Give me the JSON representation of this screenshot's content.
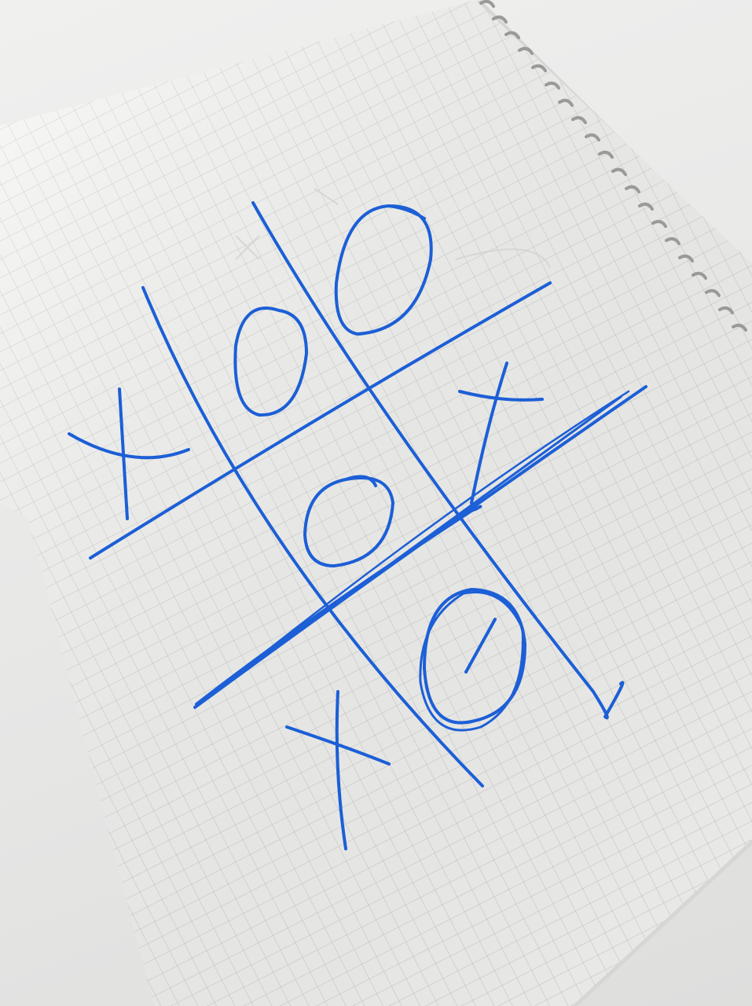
{
  "scene": {
    "subject": "hand-drawn-tic-tac-toe",
    "ink_color": "#1c5fd6",
    "paper_color": "#f7f7f5",
    "grid_line_color": "#c9c9c9",
    "background_color": "#e9e9e8"
  },
  "board": {
    "rows": [
      [
        "X",
        "O",
        "O"
      ],
      [
        "",
        "O",
        "X"
      ],
      [
        "X",
        "",
        "O"
      ]
    ],
    "winning_line": "diagonal-bottom-left-to-top-right"
  }
}
